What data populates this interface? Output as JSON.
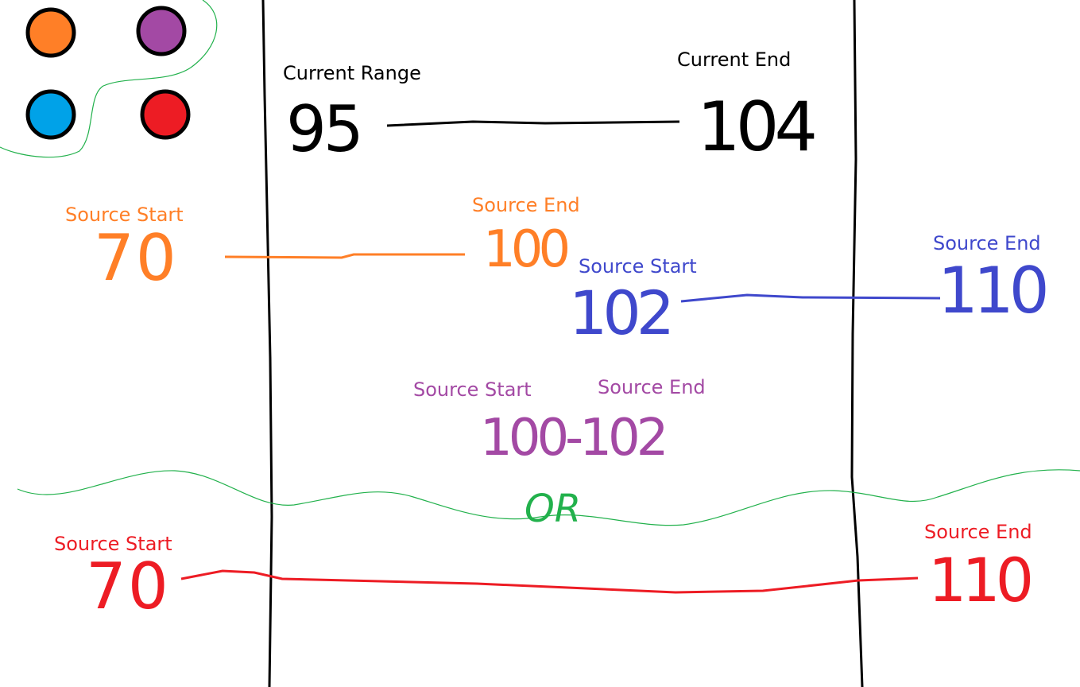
{
  "colors": {
    "black": "#000000",
    "orange": "#FF7F27",
    "purple": "#A349A4",
    "blue": "#3F48CC",
    "red": "#ED1C24",
    "green": "#22B14C",
    "legend_orange": "#FF7F27",
    "legend_purple": "#A349A4",
    "legend_blue": "#00A2E8",
    "legend_red": "#ED1C24"
  },
  "legend": {
    "dots": [
      "orange",
      "purple",
      "blue",
      "red"
    ]
  },
  "current": {
    "range_label": "Current Range",
    "end_label": "Current End",
    "start_value": "95",
    "end_value": "104"
  },
  "orange_case": {
    "start_label": "Source Start",
    "end_label": "Source End",
    "start_value": "70",
    "end_value": "100"
  },
  "blue_case": {
    "start_label": "Source Start",
    "end_label": "Source End",
    "start_value": "102",
    "end_value": "110"
  },
  "purple_case": {
    "start_label": "Source Start",
    "end_label": "Source End",
    "range_value": "100-102"
  },
  "separator": {
    "text": "OR"
  },
  "red_case": {
    "start_label": "Source Start",
    "end_label": "Source End",
    "start_value": "70",
    "end_value": "110"
  }
}
